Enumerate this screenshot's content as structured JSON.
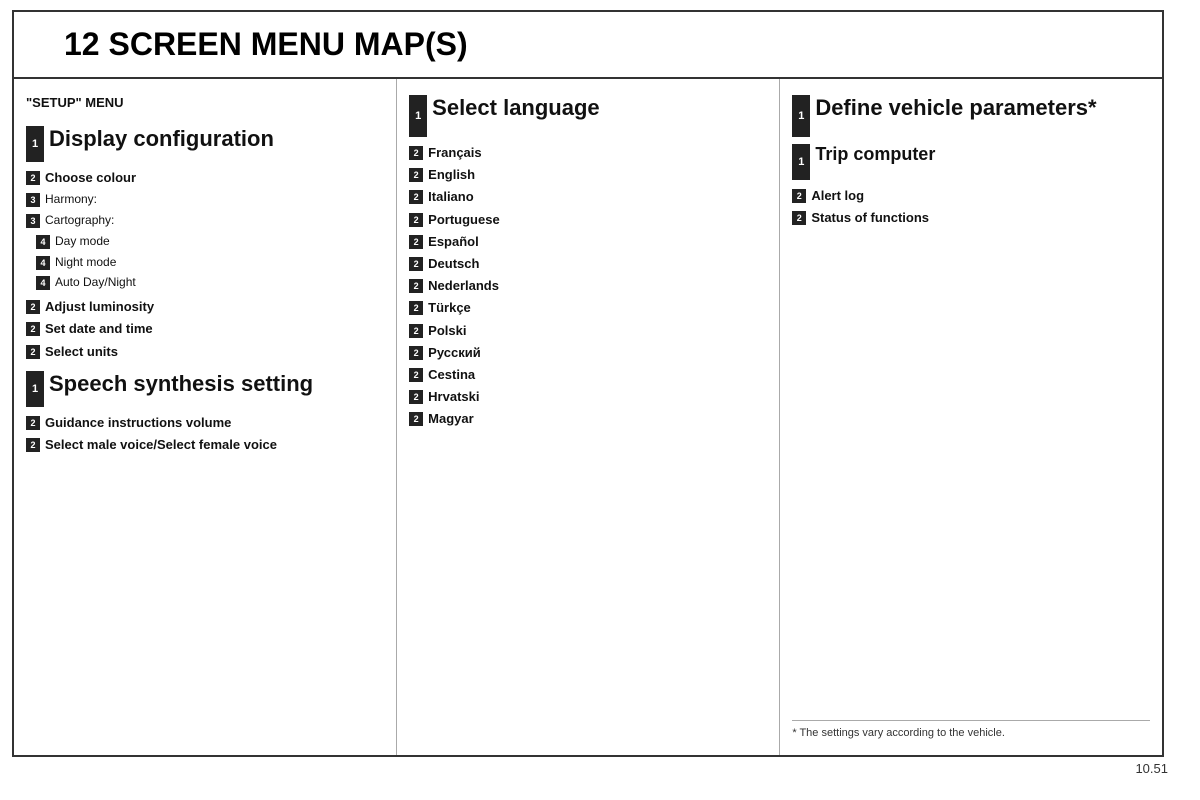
{
  "title": "12  SCREEN MENU MAP(S)",
  "col1": {
    "header": "\"SETUP\" MENU",
    "items": [
      {
        "level": "1",
        "text": "Display configuration",
        "style": "heading"
      },
      {
        "level": "2",
        "text": "Choose colour",
        "style": "bold"
      },
      {
        "level": "3",
        "text": "Harmony:",
        "style": "normal"
      },
      {
        "level": "3",
        "text": "Cartography:",
        "style": "normal"
      },
      {
        "level": "4",
        "text": "Day mode",
        "style": "normal"
      },
      {
        "level": "4",
        "text": "Night mode",
        "style": "normal"
      },
      {
        "level": "4",
        "text": "Auto Day/Night",
        "style": "normal"
      },
      {
        "level": "2",
        "text": "Adjust luminosity",
        "style": "bold"
      },
      {
        "level": "2",
        "text": "Set date and time",
        "style": "bold"
      },
      {
        "level": "2",
        "text": "Select units",
        "style": "bold"
      },
      {
        "level": "1",
        "text": "Speech synthesis setting",
        "style": "heading"
      },
      {
        "level": "2",
        "text": "Guidance instructions volume",
        "style": "bold"
      },
      {
        "level": "2",
        "text": "Select male voice/Select female voice",
        "style": "bold"
      }
    ]
  },
  "col2": {
    "items": [
      {
        "level": "1",
        "text": "Select language",
        "style": "heading"
      },
      {
        "level": "2",
        "text": "Français",
        "style": "bold"
      },
      {
        "level": "2",
        "text": "English",
        "style": "bold"
      },
      {
        "level": "2",
        "text": "Italiano",
        "style": "bold"
      },
      {
        "level": "2",
        "text": "Portuguese",
        "style": "bold"
      },
      {
        "level": "2",
        "text": "Español",
        "style": "bold"
      },
      {
        "level": "2",
        "text": "Deutsch",
        "style": "bold"
      },
      {
        "level": "2",
        "text": "Nederlands",
        "style": "bold"
      },
      {
        "level": "2",
        "text": "Türkçe",
        "style": "bold"
      },
      {
        "level": "2",
        "text": "Polski",
        "style": "bold"
      },
      {
        "level": "2",
        "text": "Русский",
        "style": "bold"
      },
      {
        "level": "2",
        "text": "Cestina",
        "style": "bold"
      },
      {
        "level": "2",
        "text": "Hrvatski",
        "style": "bold"
      },
      {
        "level": "2",
        "text": "Magyar",
        "style": "bold"
      }
    ]
  },
  "col3": {
    "items": [
      {
        "level": "1",
        "text": "Define vehicle parameters*",
        "style": "heading"
      },
      {
        "level": "1",
        "text": "Trip computer",
        "style": "subheading"
      },
      {
        "level": "2",
        "text": "Alert log",
        "style": "bold"
      },
      {
        "level": "2",
        "text": "Status of functions",
        "style": "bold"
      }
    ],
    "footnote": "* The settings vary according to the vehicle."
  },
  "page_number": "10.51"
}
